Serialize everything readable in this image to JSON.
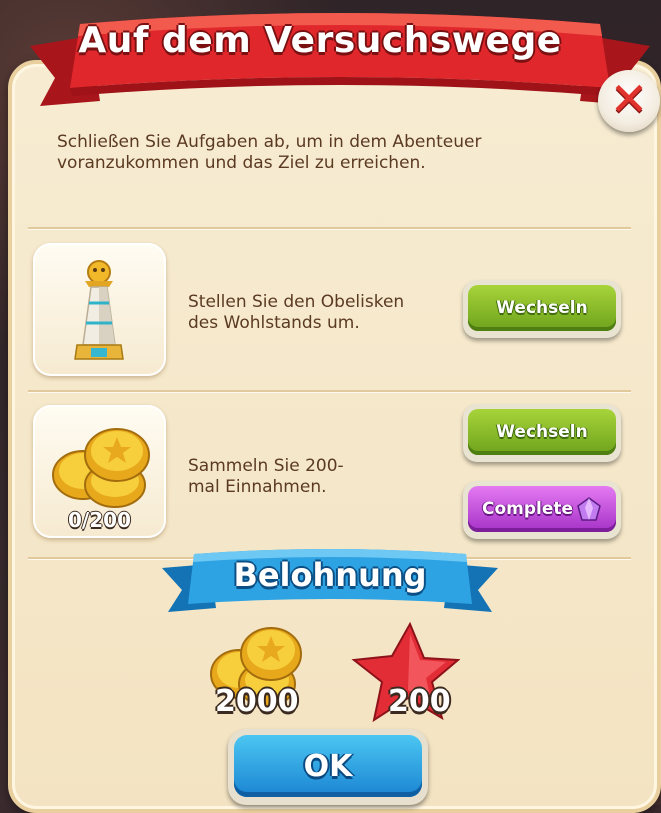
{
  "dialog": {
    "title": "Auf dem Versuchswege",
    "description_line1": "Schließen Sie Aufgaben ab, um in dem Abenteuer",
    "description_line2": "voranzukommen und das Ziel zu erreichen."
  },
  "tasks": [
    {
      "icon": "obelisk-icon",
      "text_line1": "Stellen Sie den Obelisken",
      "text_line2": "des Wohlstands um.",
      "swap_label": "Wechseln"
    },
    {
      "icon": "gold-coins-icon",
      "progress_label": "0/200",
      "progress": 0,
      "target": 200,
      "text_line1": "Sammeln Sie 200-",
      "text_line2": "mal Einnahmen.",
      "swap_label": "Wechseln",
      "complete_label": "Complete",
      "complete_icon": "purple-gem-icon"
    }
  ],
  "reward": {
    "title": "Belohnung",
    "coins": "2000",
    "coins_icon": "gold-coins-icon",
    "stars": "200",
    "stars_icon": "red-star-icon"
  },
  "ok_label": "OK",
  "colors": {
    "ribbon": "#d7262a",
    "panel": "#f5e7c9",
    "green_button": "#7fb324",
    "purple_button": "#c04ddb",
    "blue_button": "#2a9de0",
    "reward_banner": "#1e8fd6"
  }
}
